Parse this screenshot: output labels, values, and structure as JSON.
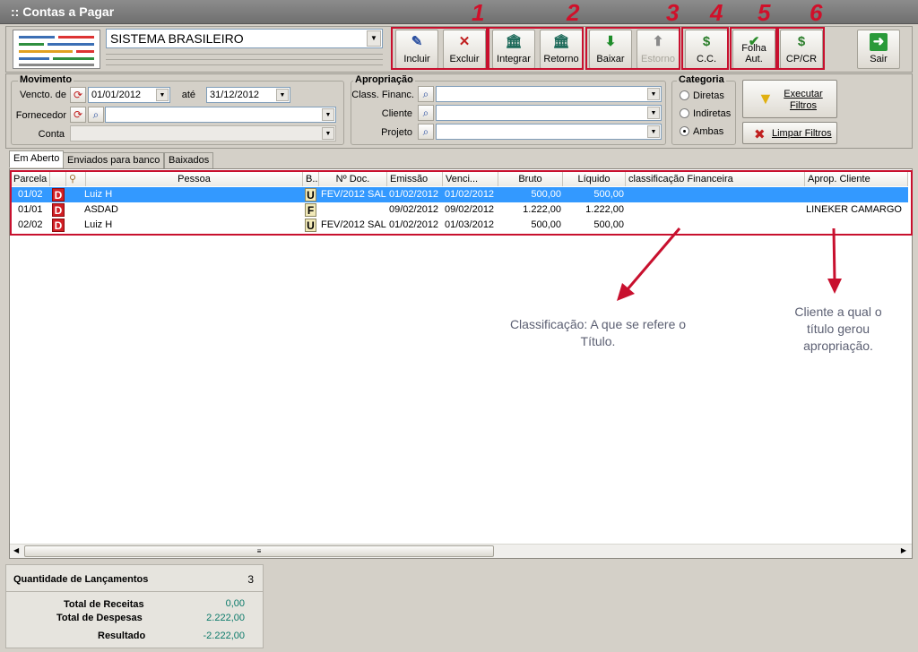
{
  "window": {
    "title": ":: Contas a Pagar"
  },
  "company": {
    "selected": "SISTEMA BRASILEIRO"
  },
  "toolbar": {
    "buttons": [
      {
        "label": "Incluir",
        "icon": "document-new-icon"
      },
      {
        "label": "Excluir",
        "icon": "document-delete-icon"
      },
      {
        "label": "Integrar",
        "icon": "bank-icon"
      },
      {
        "label": "Retorno",
        "icon": "bank-return-icon"
      },
      {
        "label": "Baixar",
        "icon": "down-arrow-icon"
      },
      {
        "label": "Estorno",
        "icon": "up-arrow-icon",
        "disabled": true
      },
      {
        "label": "C.C.",
        "icon": "money-icon"
      },
      {
        "label": "Folha Aut.",
        "icon": "check-icon"
      },
      {
        "label": "CP/CR",
        "icon": "money-icon"
      },
      {
        "label": "Sair",
        "icon": "exit-arrow-icon"
      }
    ]
  },
  "annotations": {
    "numbers": [
      "1",
      "2",
      "3",
      "4",
      "5",
      "6"
    ],
    "classificacao": "Classificação: A que se refere o Título.",
    "cliente": "Cliente a qual o título gerou apropriação."
  },
  "movimento": {
    "title": "Movimento",
    "vencto_label": "Vencto. de",
    "date_from": "01/01/2012",
    "ate_label": "até",
    "date_to": "31/12/2012",
    "fornecedor_label": "Fornecedor",
    "conta_label": "Conta"
  },
  "apropriacao": {
    "title": "Apropriação",
    "class_label": "Class. Financ.",
    "cliente_label": "Cliente",
    "projeto_label": "Projeto"
  },
  "categoria": {
    "title": "Categoria",
    "options": [
      "Diretas",
      "Indiretas",
      "Ambas"
    ],
    "selected": "Ambas"
  },
  "filters": {
    "execute": "Executar Filtros",
    "clear": "Limpar Filtros"
  },
  "tabs": [
    "Em Aberto",
    "Enviados para banco",
    "Baixados"
  ],
  "grid": {
    "headers": [
      "Parcela",
      "Pessoa",
      "B..",
      "Nº Doc.",
      "Emissão",
      "Venci...",
      "Bruto",
      "Líquido",
      "classificação Financeira",
      "Aprop. Cliente"
    ],
    "rows": [
      {
        "parcela": "01/02",
        "flag": "D",
        "pessoa": "Luiz H",
        "b": "U",
        "doc": "FEV/2012 SAL",
        "emissao": "01/02/2012",
        "venc": "01/02/2012",
        "bruto": "500,00",
        "liquido": "500,00",
        "classif": "",
        "cliente": ""
      },
      {
        "parcela": "01/01",
        "flag": "D",
        "pessoa": "ASDAD",
        "b": "F",
        "doc": "",
        "emissao": "09/02/2012",
        "venc": "09/02/2012",
        "bruto": "1.222,00",
        "liquido": "1.222,00",
        "classif": "",
        "cliente": "LINEKER CAMARGO"
      },
      {
        "parcela": "02/02",
        "flag": "D",
        "pessoa": "Luiz H",
        "b": "U",
        "doc": "FEV/2012 SAL",
        "emissao": "01/02/2012",
        "venc": "01/03/2012",
        "bruto": "500,00",
        "liquido": "500,00",
        "classif": "",
        "cliente": ""
      }
    ]
  },
  "summary": {
    "qtd_label": "Quantidade de Lançamentos",
    "qtd_value": "3",
    "receitas_label": "Total de Receitas",
    "receitas_value": "0,00",
    "despesas_label": "Total de Despesas",
    "despesas_value": "2.222,00",
    "resultado_label": "Resultado",
    "resultado_value": "-2.222,00"
  },
  "colors": {
    "accent_red": "#c8102e",
    "selection": "#3399ff",
    "value_green": "#0b7a6a"
  }
}
